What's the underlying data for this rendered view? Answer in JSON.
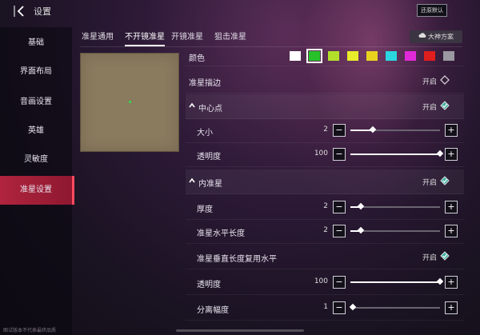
{
  "header": {
    "title": "设置",
    "reset_label": "还原默认"
  },
  "sidebar": {
    "items": [
      {
        "label": "基础"
      },
      {
        "label": "界面布局"
      },
      {
        "label": "音画设置"
      },
      {
        "label": "英雄"
      },
      {
        "label": "灵敏度"
      },
      {
        "label": "准星设置",
        "active": true
      }
    ]
  },
  "tabs": [
    {
      "label": "准星通用"
    },
    {
      "label": "不开镜准星",
      "active": true
    },
    {
      "label": "开镜准星"
    },
    {
      "label": "狙击准星"
    }
  ],
  "master_button": {
    "label": "大神方案",
    "icon": "cloud-icon"
  },
  "preview": {
    "dot_color": "#27e34a"
  },
  "colors": {
    "label": "颜色",
    "swatches": [
      "#ffffff",
      "#27c22a",
      "#b2e02a",
      "#e8ec2a",
      "#e8d21e",
      "#2ad6e0",
      "#e02ad8",
      "#e01e1e",
      "#9a98a0"
    ],
    "selected_index": 1
  },
  "rows": {
    "outline": {
      "label": "准星描边",
      "state": "开启"
    },
    "center_section": {
      "label": "中心点",
      "state": "开启"
    },
    "center_size": {
      "label": "大小",
      "value": "2",
      "fraction": 0.25
    },
    "center_opacity": {
      "label": "透明度",
      "value": "100",
      "fraction": 1.0
    },
    "inner_section": {
      "label": "内准星",
      "state": "开启"
    },
    "inner_thickness": {
      "label": "厚度",
      "value": "2",
      "fraction": 0.12
    },
    "inner_h_length": {
      "label": "准星水平长度",
      "value": "2",
      "fraction": 0.12
    },
    "inner_v_reuse": {
      "label": "准星垂直长度复用水平",
      "state": "开启"
    },
    "inner_opacity": {
      "label": "透明度",
      "value": "100",
      "fraction": 1.0
    },
    "inner_gap": {
      "label": "分离幅度",
      "value": "1",
      "fraction": 0.03
    }
  },
  "footer": {
    "note": "图试版本不代表最终品质"
  },
  "accent": "#b0243e"
}
